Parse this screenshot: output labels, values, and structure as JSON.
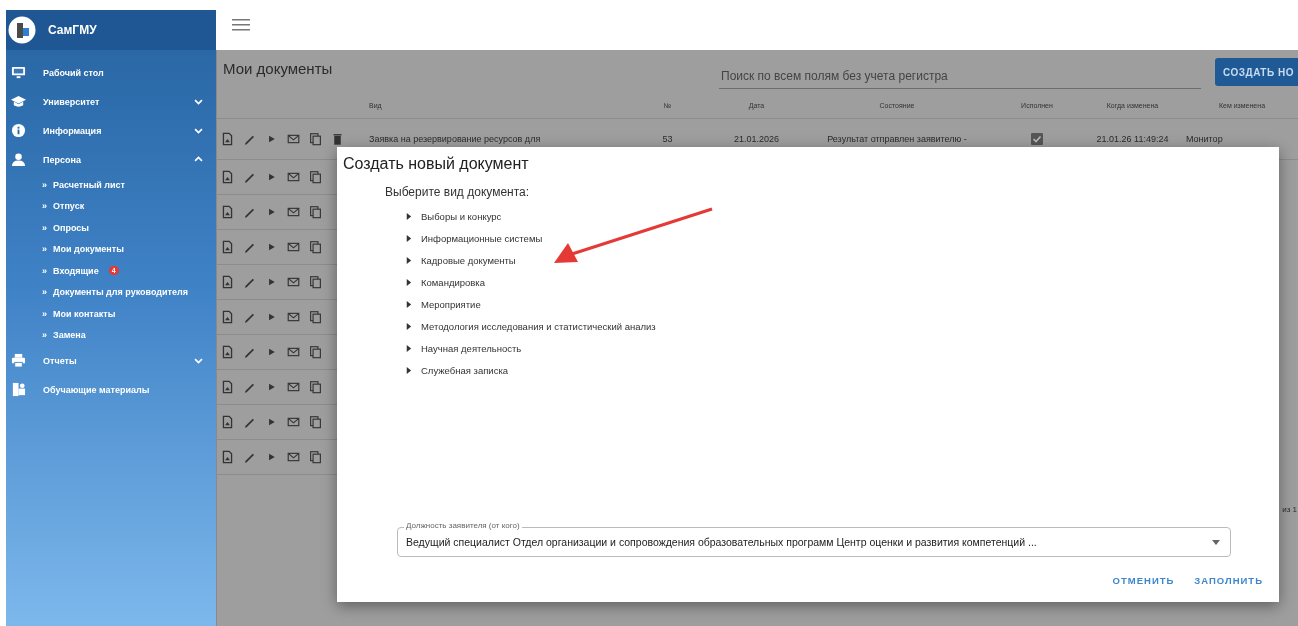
{
  "sidebar": {
    "brand": "СамГМУ",
    "items": [
      {
        "label": "Рабочий стол",
        "kind": "monitor"
      },
      {
        "label": "Университет",
        "kind": "cap",
        "expanded": false
      },
      {
        "label": "Информация",
        "kind": "info",
        "expanded": false
      },
      {
        "label": "Персона",
        "kind": "person",
        "expanded": true,
        "children": [
          {
            "marker": "»",
            "label": "Расчетный лист"
          },
          {
            "marker": "»",
            "label": "Отпуск"
          },
          {
            "marker": "»",
            "label": "Опросы"
          },
          {
            "marker": "»",
            "label": "Мои документы"
          },
          {
            "marker": "»",
            "label": "Входящие",
            "badge": "4"
          },
          {
            "marker": "»",
            "label": "Документы для руководителя"
          },
          {
            "marker": "»",
            "label": "Мои контакты"
          },
          {
            "marker": "»",
            "label": "Замена"
          }
        ]
      },
      {
        "label": "Отчеты",
        "kind": "printer",
        "expanded": false
      },
      {
        "label": "Обучающие материалы",
        "kind": "materials"
      }
    ]
  },
  "page": {
    "title": "Мои документы",
    "search": {
      "placeholder": "Поиск по всем полям без учета регистра"
    },
    "create_button": "СОЗДАТЬ НО",
    "pager": "из 1"
  },
  "table": {
    "columns": [
      "Вид",
      "№",
      "Дата",
      "Состояние",
      "Исполнен",
      "Когда изменена",
      "Кем изменена"
    ],
    "rows": [
      {
        "actions": [
          {
            "kind": "document"
          },
          {
            "kind": "edit"
          },
          {
            "kind": "run"
          },
          {
            "kind": "mail"
          },
          {
            "kind": "copy"
          },
          {
            "kind": "delete"
          }
        ],
        "cells": [
          "Заявка на резервирование ресурсов для",
          "53",
          "21.01.2026",
          "Результат отправлен заявителю -"
        ],
        "done": true,
        "changed_at": "21.01.26 11:49:24",
        "changed_by": "Монитор"
      },
      {
        "actions": [
          {
            "kind": "document"
          },
          {
            "kind": "edit"
          },
          {
            "kind": "run"
          },
          {
            "kind": "mail"
          },
          {
            "kind": "copy"
          }
        ]
      },
      {
        "actions": [
          {
            "kind": "document"
          },
          {
            "kind": "edit"
          },
          {
            "kind": "run"
          },
          {
            "kind": "mail"
          },
          {
            "kind": "copy"
          }
        ]
      },
      {
        "actions": [
          {
            "kind": "document"
          },
          {
            "kind": "edit"
          },
          {
            "kind": "run"
          },
          {
            "kind": "mail"
          },
          {
            "kind": "copy"
          }
        ]
      },
      {
        "actions": [
          {
            "kind": "document"
          },
          {
            "kind": "edit"
          },
          {
            "kind": "run"
          },
          {
            "kind": "mail"
          },
          {
            "kind": "copy"
          }
        ]
      },
      {
        "actions": [
          {
            "kind": "document"
          },
          {
            "kind": "edit"
          },
          {
            "kind": "run"
          },
          {
            "kind": "mail"
          },
          {
            "kind": "copy"
          }
        ]
      },
      {
        "actions": [
          {
            "kind": "document"
          },
          {
            "kind": "edit"
          },
          {
            "kind": "run"
          },
          {
            "kind": "mail"
          },
          {
            "kind": "copy"
          }
        ]
      },
      {
        "actions": [
          {
            "kind": "document"
          },
          {
            "kind": "edit"
          },
          {
            "kind": "run"
          },
          {
            "kind": "mail"
          },
          {
            "kind": "copy"
          }
        ]
      },
      {
        "actions": [
          {
            "kind": "document"
          },
          {
            "kind": "edit"
          },
          {
            "kind": "run"
          },
          {
            "kind": "mail"
          },
          {
            "kind": "copy"
          }
        ]
      },
      {
        "actions": [
          {
            "kind": "document"
          },
          {
            "kind": "edit"
          },
          {
            "kind": "run"
          },
          {
            "kind": "mail"
          },
          {
            "kind": "copy"
          }
        ]
      }
    ]
  },
  "dialog": {
    "title": "Создать новый документ",
    "prompt": "Выберите вид документа:",
    "types": [
      {
        "label": "Выборы и конкурс",
        "expanded": false
      },
      {
        "label": "Информационные системы",
        "expanded": false
      },
      {
        "label": "Кадровые документы",
        "expanded": false,
        "highlighted": true
      },
      {
        "label": "Командировка",
        "expanded": false
      },
      {
        "label": "Мероприятие",
        "expanded": false
      },
      {
        "label": "Методология исследования и статистический анализ",
        "expanded": false
      },
      {
        "label": "Научная деятельность",
        "expanded": false
      },
      {
        "label": "Служебная записка",
        "expanded": false
      }
    ],
    "position_field": {
      "label": "Должность заявителя (от кого)",
      "value": "Ведущий специалист Отдел организации и сопровождения образовательных программ Центр оценки и развития компетенций ..."
    },
    "buttons": [
      "ОТМЕНИТЬ",
      "ЗАПОЛНИТЬ"
    ]
  }
}
